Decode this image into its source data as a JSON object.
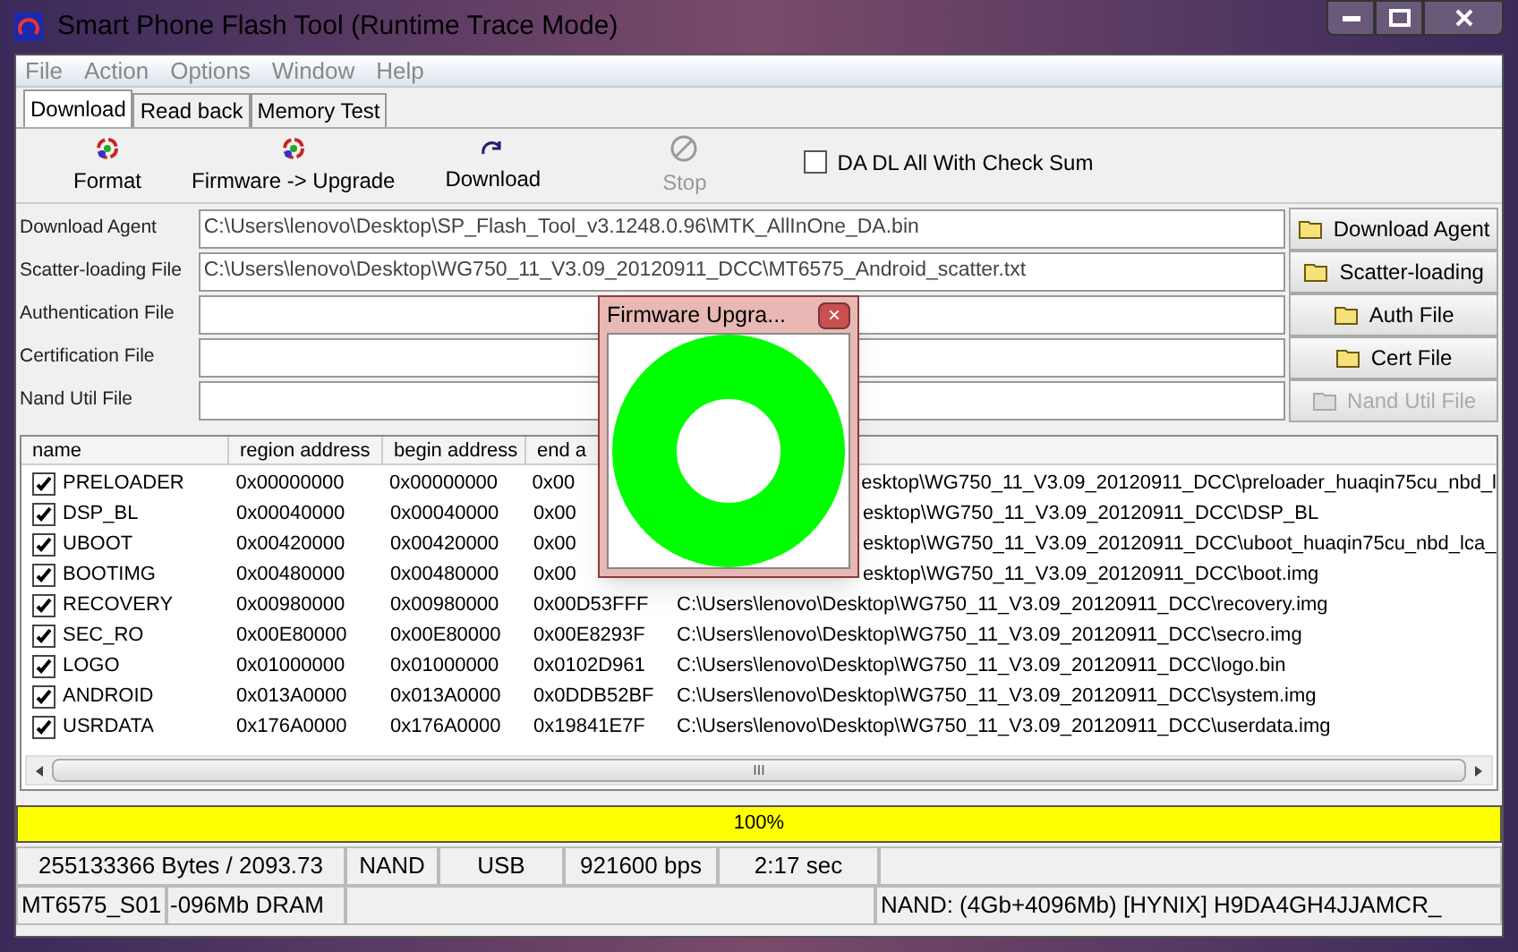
{
  "window": {
    "title": "Smart Phone Flash Tool (Runtime Trace Mode)"
  },
  "menu": [
    "File",
    "Action",
    "Options",
    "Window",
    "Help"
  ],
  "tabs": [
    {
      "label": "Download",
      "selected": true
    },
    {
      "label": "Read back",
      "selected": false
    },
    {
      "label": "Memory Test",
      "selected": false
    }
  ],
  "toolbar": [
    {
      "label": "Format",
      "kind": "format",
      "disabled": false
    },
    {
      "label": "Firmware -> Upgrade",
      "kind": "format",
      "disabled": false
    },
    {
      "label": "Download",
      "kind": "download",
      "disabled": false
    },
    {
      "label": "Stop",
      "kind": "stop",
      "disabled": true
    }
  ],
  "checksum": {
    "label": "DA DL All With Check Sum",
    "checked": false
  },
  "files": [
    {
      "label": "Download Agent",
      "value": "C:\\Users\\lenovo\\Desktop\\SP_Flash_Tool_v3.1248.0.96\\MTK_AllInOne_DA.bin",
      "button": "Download Agent",
      "disabled": false
    },
    {
      "label": "Scatter-loading File",
      "value": "C:\\Users\\lenovo\\Desktop\\WG750_11_V3.09_20120911_DCC\\MT6575_Android_scatter.txt",
      "button": "Scatter-loading",
      "disabled": false
    },
    {
      "label": "Authentication File",
      "button": "Auth File",
      "disabled": false
    },
    {
      "label": "Certification File",
      "button": "Cert File",
      "disabled": false
    },
    {
      "label": "Nand Util File",
      "button": "Nand Util File",
      "disabled": true
    }
  ],
  "table": {
    "columns": [
      "name",
      "region address",
      "begin address",
      "end a"
    ],
    "rows": [
      {
        "name": "PRELOADER",
        "checked": true,
        "region": "0x00000000",
        "begin": "0x00000000",
        "end": "0x00",
        "path": "esktop\\WG750_11_V3.09_20120911_DCC\\preloader_huaqin75cu_nbd_l",
        "covered": true
      },
      {
        "name": "DSP_BL",
        "checked": true,
        "region": "0x00040000",
        "begin": "0x00040000",
        "end": "0x00",
        "path": "esktop\\WG750_11_V3.09_20120911_DCC\\DSP_BL",
        "covered": true
      },
      {
        "name": "UBOOT",
        "checked": true,
        "region": "0x00420000",
        "begin": "0x00420000",
        "end": "0x00",
        "path": "esktop\\WG750_11_V3.09_20120911_DCC\\uboot_huaqin75cu_nbd_lca_",
        "covered": true
      },
      {
        "name": "BOOTIMG",
        "checked": true,
        "region": "0x00480000",
        "begin": "0x00480000",
        "end": "0x00",
        "path": "esktop\\WG750_11_V3.09_20120911_DCC\\boot.img",
        "covered": true
      },
      {
        "name": "RECOVERY",
        "checked": true,
        "region": "0x00980000",
        "begin": "0x00980000",
        "end": "0x00D53FFF",
        "path": "C:\\Users\\lenovo\\Desktop\\WG750_11_V3.09_20120911_DCC\\recovery.img",
        "covered": false
      },
      {
        "name": "SEC_RO",
        "checked": true,
        "region": "0x00E80000",
        "begin": "0x00E80000",
        "end": "0x00E8293F",
        "path": "C:\\Users\\lenovo\\Desktop\\WG750_11_V3.09_20120911_DCC\\secro.img",
        "covered": false
      },
      {
        "name": "LOGO",
        "checked": true,
        "region": "0x01000000",
        "begin": "0x01000000",
        "end": "0x0102D961",
        "path": "C:\\Users\\lenovo\\Desktop\\WG750_11_V3.09_20120911_DCC\\logo.bin",
        "covered": false
      },
      {
        "name": "ANDROID",
        "checked": true,
        "region": "0x013A0000",
        "begin": "0x013A0000",
        "end": "0x0DDB52BF",
        "path": "C:\\Users\\lenovo\\Desktop\\WG750_11_V3.09_20120911_DCC\\system.img",
        "covered": false
      },
      {
        "name": "USRDATA",
        "checked": true,
        "region": "0x176A0000",
        "begin": "0x176A0000",
        "end": "0x19841E7F",
        "path": "C:\\Users\\lenovo\\Desktop\\WG750_11_V3.09_20120911_DCC\\userdata.img",
        "covered": false
      }
    ]
  },
  "scrollbar_grip": "III",
  "progress": {
    "level": 1,
    "text": "100%"
  },
  "status_bar": {
    "row_1": [
      "255133366 Bytes / 2093.73",
      "NAND",
      "USB",
      "921600 bps",
      "2:17 sec"
    ],
    "row_2": [
      "MT6575_S01",
      "-096Mb DRAM",
      "NAND: (4Gb+4096Mb) [HYNIX] H9DA4GH4JJAMCR_"
    ]
  },
  "dialog": {
    "title": "Firmware Upgra...",
    "close": "×"
  }
}
